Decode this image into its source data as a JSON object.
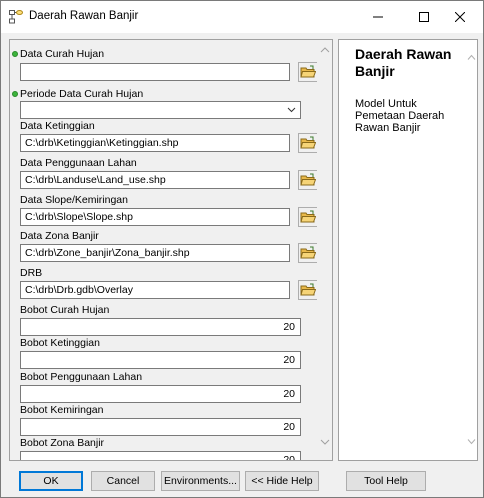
{
  "window": {
    "title": "Daerah Rawan Banjir",
    "minimize": "—",
    "maximize": "☐",
    "close": "✕"
  },
  "params": [
    {
      "label": "Data Curah Hujan",
      "value": "",
      "required": true,
      "kind": "file"
    },
    {
      "label": "Periode Data Curah Hujan",
      "value": "",
      "required": true,
      "kind": "select"
    },
    {
      "label": "Data Ketinggian",
      "value": "C:\\drb\\Ketinggian\\Ketinggian.shp",
      "required": false,
      "kind": "file"
    },
    {
      "label": "Data Penggunaan Lahan",
      "value": "C:\\drb\\Landuse\\Land_use.shp",
      "required": false,
      "kind": "file"
    },
    {
      "label": "Data Slope/Kemiringan",
      "value": "C:\\drb\\Slope\\Slope.shp",
      "required": false,
      "kind": "file"
    },
    {
      "label": "Data Zona Banjir",
      "value": "C:\\drb\\Zone_banjir\\Zona_banjir.shp",
      "required": false,
      "kind": "file"
    },
    {
      "label": "DRB",
      "value": "C:\\drb\\Drb.gdb\\Overlay",
      "required": false,
      "kind": "file"
    },
    {
      "label": "Bobot Curah Hujan",
      "value": "20",
      "required": false,
      "kind": "number"
    },
    {
      "label": "Bobot Ketinggian",
      "value": "20",
      "required": false,
      "kind": "number"
    },
    {
      "label": "Bobot Penggunaan Lahan",
      "value": "20",
      "required": false,
      "kind": "number"
    },
    {
      "label": "Bobot Kemiringan",
      "value": "20",
      "required": false,
      "kind": "number"
    },
    {
      "label": "Bobot Zona Banjir",
      "value": "20",
      "required": false,
      "kind": "number"
    }
  ],
  "help": {
    "title": "Daerah Rawan Banjir",
    "description": "Model Untuk Pemetaan Daerah Rawan Banjir"
  },
  "buttons": {
    "ok": "OK",
    "cancel": "Cancel",
    "environments": "Environments...",
    "hide_help": "<< Hide Help",
    "tool_help": "Tool Help"
  },
  "colors": {
    "required_dot": "#3cb43c",
    "ok_border": "#0078d7",
    "folder": "#e8b84a"
  }
}
